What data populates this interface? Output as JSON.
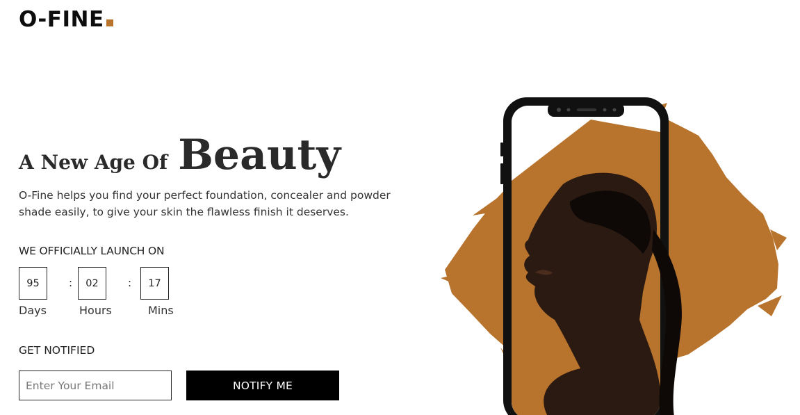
{
  "brand": {
    "name": "O-FINE",
    "accent_color": "#b8732d"
  },
  "hero": {
    "headline_small": "A New Age Of",
    "headline_big": "Beauty",
    "description": "O-Fine helps you find your perfect foundation, concealer and powder shade easily, to give your skin the flawless finish it deserves."
  },
  "countdown": {
    "title": "WE OFFICIALLY LAUNCH ON",
    "separator": ":",
    "days": {
      "value": "95",
      "label": "Days"
    },
    "hours": {
      "value": "02",
      "label": "Hours"
    },
    "mins": {
      "value": "17",
      "label": "Mins"
    }
  },
  "notify": {
    "title": "GET NOTIFIED",
    "email_placeholder": "Enter Your Email",
    "email_value": "",
    "button_label": "NOTIFY ME"
  },
  "image": {
    "icon": "phone-with-woman-profile-illustration",
    "paint_color": "#b8732d"
  }
}
